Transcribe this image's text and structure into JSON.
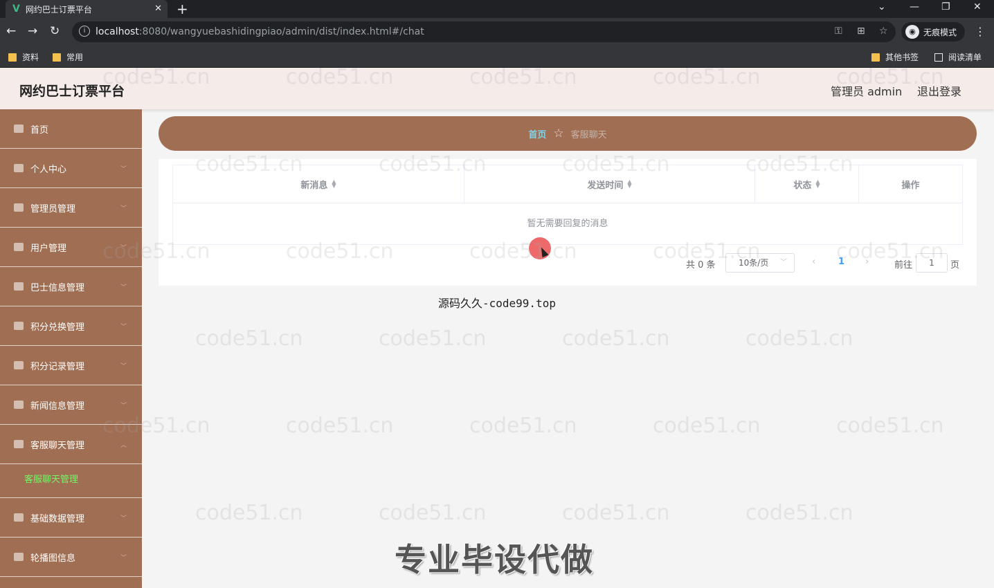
{
  "browser": {
    "tab_title": "网约巴士订票平台",
    "tab_logo": "V",
    "tab_close": "✕",
    "new_tab": "+",
    "url_host": "localhost",
    "url_rest": ":8080/wangyuebashidingpiao/admin/dist/index.html#/chat",
    "incognito_label": "无痕模式",
    "bookmarks": [
      "资料",
      "常用"
    ],
    "other_bookmarks": "其他书签",
    "reading_list": "阅读清单"
  },
  "header": {
    "title": "网约巴士订票平台",
    "admin": "管理员 admin",
    "logout": "退出登录"
  },
  "sidebar": {
    "items": [
      {
        "label": "首页",
        "icon": "home-icon"
      },
      {
        "label": "个人中心",
        "icon": "user-icon"
      },
      {
        "label": "管理员管理",
        "icon": "mail-icon"
      },
      {
        "label": "用户管理",
        "icon": "users-icon"
      },
      {
        "label": "巴士信息管理",
        "icon": "bus-icon"
      },
      {
        "label": "积分兑换管理",
        "icon": "gift-icon"
      },
      {
        "label": "积分记录管理",
        "icon": "grid-icon"
      },
      {
        "label": "新闻信息管理",
        "icon": "news-icon"
      },
      {
        "label": "客服聊天管理",
        "icon": "chat-icon"
      },
      {
        "label": "基础数据管理",
        "icon": "data-icon"
      },
      {
        "label": "轮播图信息",
        "icon": "image-icon"
      }
    ],
    "sub_item": "客服聊天管理"
  },
  "breadcrumb": {
    "home": "首页",
    "current": "客服聊天"
  },
  "table": {
    "columns": [
      "新消息",
      "发送时间",
      "状态",
      "操作"
    ],
    "empty_text": "暂无需要回复的消息"
  },
  "pagination": {
    "total": "共 0 条",
    "page_size": "10条/页",
    "current_page": "1",
    "goto_label": "前往",
    "goto_value": "1",
    "page_suffix": "页"
  },
  "overlay": {
    "source_text": "源码久久-code99.top",
    "promo_text": "专业毕设代做",
    "watermark": "code51.cn"
  }
}
